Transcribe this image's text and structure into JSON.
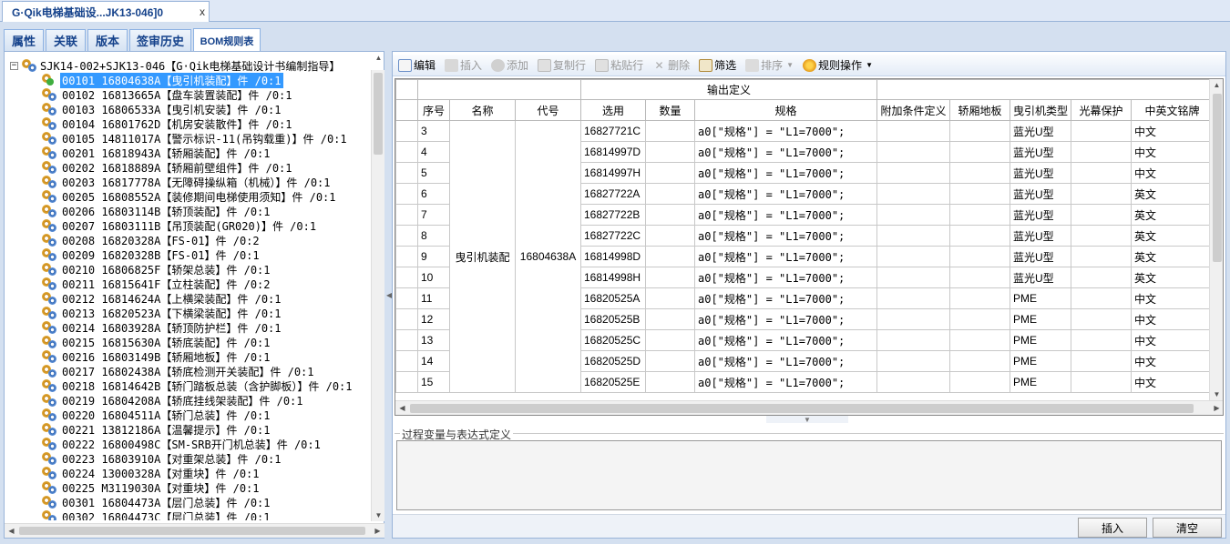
{
  "doc_tab": {
    "title": "G·Qik电梯基础设...JK13-046]0",
    "close": "x"
  },
  "sub_tabs": [
    "属性",
    "关联",
    "版本",
    "签审历史",
    "BOM规则表"
  ],
  "tree": {
    "root": {
      "expander": "−",
      "label": "SJK14-002+SJK13-046【G·Qik电梯基础设计书编制指导】"
    },
    "items": [
      "00101 16804638A【曳引机装配】件 /0:1",
      "00102 16813665A【盘车装置装配】件 /0:1",
      "00103 16806533A【曳引机安装】件 /0:1",
      "00104 16801762D【机房安装散件】件 /0:1",
      "00105 14811017A【警示标识-11(吊钩载重)】件 /0:1",
      "00201 16818943A【轿厢装配】件 /0:1",
      "00202 16818889A【轿厢前壁组件】件 /0:1",
      "00203 16817778A【无障碍操纵箱（机械）】件 /0:1",
      "00205 16808552A【装修期间电梯使用须知】件 /0:1",
      "00206 16803114B【轿顶装配】件 /0:1",
      "00207 16803111B【吊顶装配(GR020)】件 /0:1",
      "00208 16820328A【FS-01】件 /0:2",
      "00209 16820328B【FS-01】件 /0:1",
      "00210 16806825F【轿架总装】件 /0:1",
      "00211 16815641F【立柱装配】件 /0:2",
      "00212 16814624A【上横梁装配】件 /0:1",
      "00213 16820523A【下横梁装配】件 /0:1",
      "00214 16803928A【轿顶防护栏】件 /0:1",
      "00215 16815630A【轿底装配】件 /0:1",
      "00216 16803149B【轿厢地板】件 /0:1",
      "00217 16802438A【轿底检测开关装配】件 /0:1",
      "00218 16814642B【轿门踏板总装（含护脚板）】件 /0:1",
      "00219 16804208A【轿底挂线架装配】件 /0:1",
      "00220 16804511A【轿门总装】件 /0:1",
      "00221 13812186A【温馨提示】件 /0:1",
      "00222 16800498C【SM-SRB开门机总装】件 /0:1",
      "00223 16803910A【对重架总装】件 /0:1",
      "00224 13000328A【对重块】件 /0:1",
      "00225 M3119030A【对重块】件 /0:1",
      "00301 16804473A【层门总装】件 /0:1",
      "00302 16804473C【层门总装】件 /0:1"
    ]
  },
  "toolbar": {
    "edit": "编辑",
    "insert": "插入",
    "add": "添加",
    "copy_row": "复制行",
    "paste_row": "粘贴行",
    "delete": "删除",
    "filter": "筛选",
    "sort": "排序",
    "rule_ops": "规则操作"
  },
  "grid": {
    "group_header": "输出定义",
    "columns": [
      "序号",
      "名称",
      "代号",
      "选用",
      "数量",
      "规格",
      "附加条件定义",
      "轿厢地板",
      "曳引机类型",
      "光幕保护",
      "中英文铭牌"
    ],
    "merged_name": "曳引机装配",
    "merged_code": "16804638A",
    "rows": [
      {
        "seq": "3",
        "select": "16827721C",
        "spec": "a0[\"规格\"] = \"L1=7000\";",
        "motor": "蓝光U型",
        "plate": "中文"
      },
      {
        "seq": "4",
        "select": "16814997D",
        "spec": "a0[\"规格\"] = \"L1=7000\";",
        "motor": "蓝光U型",
        "plate": "中文"
      },
      {
        "seq": "5",
        "select": "16814997H",
        "spec": "a0[\"规格\"] = \"L1=7000\";",
        "motor": "蓝光U型",
        "plate": "中文"
      },
      {
        "seq": "6",
        "select": "16827722A",
        "spec": "a0[\"规格\"] = \"L1=7000\";",
        "motor": "蓝光U型",
        "plate": "英文"
      },
      {
        "seq": "7",
        "select": "16827722B",
        "spec": "a0[\"规格\"] = \"L1=7000\";",
        "motor": "蓝光U型",
        "plate": "英文"
      },
      {
        "seq": "8",
        "select": "16827722C",
        "spec": "a0[\"规格\"] = \"L1=7000\";",
        "motor": "蓝光U型",
        "plate": "英文"
      },
      {
        "seq": "9",
        "select": "16814998D",
        "spec": "a0[\"规格\"] = \"L1=7000\";",
        "motor": "蓝光U型",
        "plate": "英文"
      },
      {
        "seq": "10",
        "select": "16814998H",
        "spec": "a0[\"规格\"] = \"L1=7000\";",
        "motor": "蓝光U型",
        "plate": "英文"
      },
      {
        "seq": "11",
        "select": "16820525A",
        "spec": "a0[\"规格\"] = \"L1=7000\";",
        "motor": "PME",
        "plate": "中文"
      },
      {
        "seq": "12",
        "select": "16820525B",
        "spec": "a0[\"规格\"] = \"L1=7000\";",
        "motor": "PME",
        "plate": "中文"
      },
      {
        "seq": "13",
        "select": "16820525C",
        "spec": "a0[\"规格\"] = \"L1=7000\";",
        "motor": "PME",
        "plate": "中文"
      },
      {
        "seq": "14",
        "select": "16820525D",
        "spec": "a0[\"规格\"] = \"L1=7000\";",
        "motor": "PME",
        "plate": "中文"
      },
      {
        "seq": "15",
        "select": "16820525E",
        "spec": "a0[\"规格\"] = \"L1=7000\";",
        "motor": "PME",
        "plate": "中文"
      }
    ]
  },
  "expr_section": {
    "legend": "过程变量与表达式定义",
    "value": ""
  },
  "buttons": {
    "insert": "插入",
    "clear": "清空"
  },
  "colors": {
    "selection": "#3399ff",
    "tab_text": "#15428b",
    "border": "#99b4d9",
    "background": "#d4e0f0"
  }
}
